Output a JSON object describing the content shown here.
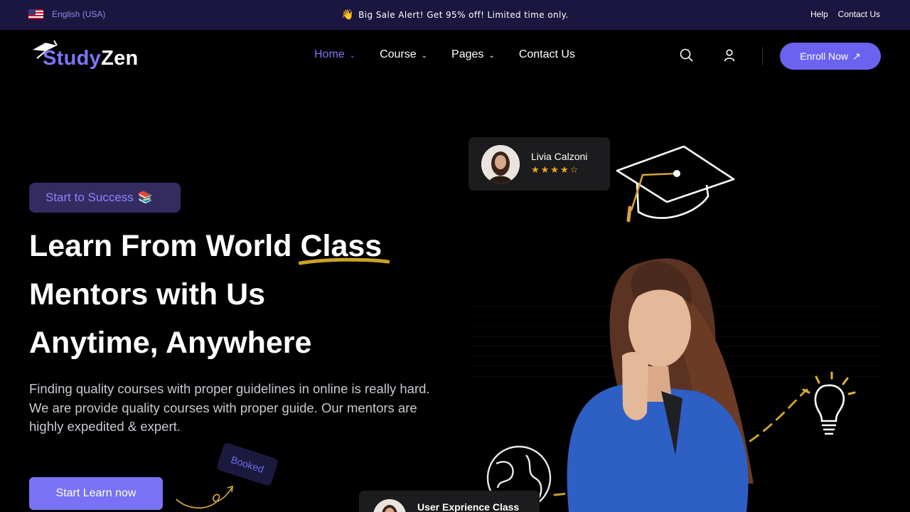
{
  "topbar": {
    "language": "English (USA)",
    "promo_emoji": "👋",
    "promo": "Big Sale Alert! Get 95% off! Limited time only.",
    "links": [
      "Help",
      "Contact Us"
    ]
  },
  "brand": {
    "study": "Study",
    "zen": "Zen"
  },
  "nav": {
    "items": [
      {
        "label": "Home",
        "dropdown": true,
        "active": true
      },
      {
        "label": "Course",
        "dropdown": true
      },
      {
        "label": "Pages",
        "dropdown": true
      },
      {
        "label": "Contact Us",
        "dropdown": false
      }
    ],
    "enroll_label": "Enroll Now"
  },
  "hero": {
    "tag": "Start to Success",
    "tag_emoji": "📚",
    "headline_line1_a": "Learn From World ",
    "headline_line1_b": "Class",
    "headline_line2": "Mentors with Us",
    "headline_line3": "Anytime, Anywhere",
    "description": "Finding quality courses with proper guidelines in online is really hard. We are provide quality courses with proper guide. Our mentors are highly expedited & expert.",
    "cta": "Start Learn now",
    "booked": "Booked"
  },
  "review_card": {
    "name": "Livia Calzoni",
    "stars": "★★★★☆",
    "rating": 4
  },
  "ux_card": {
    "title": "User Exprience Class"
  },
  "colors": {
    "accent": "#6b63f0",
    "topbar": "#1b1640",
    "highlight": "#c9a227"
  }
}
